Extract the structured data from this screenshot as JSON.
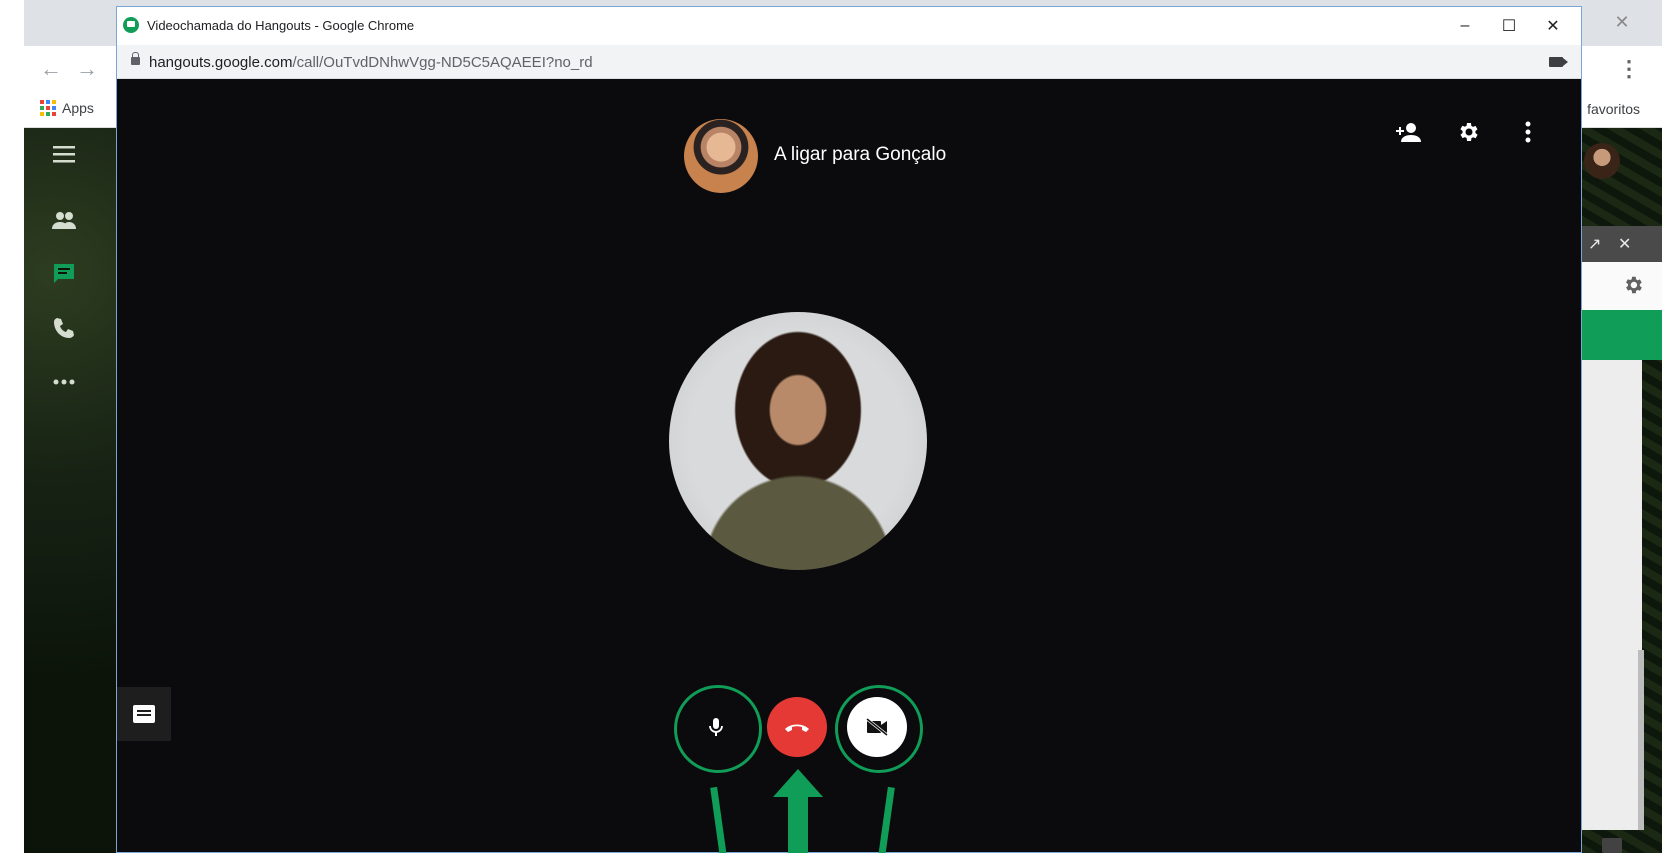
{
  "background_browser": {
    "apps_label": "Apps",
    "bookmark_right_label": "favoritos",
    "close_glyph": "✕",
    "nav_back": "←",
    "nav_forward": "→",
    "menu_glyph": "⋮"
  },
  "hangouts_rail": {
    "icons": [
      "menu-icon",
      "contacts-icon",
      "chat-icon",
      "phone-icon",
      "more-icon"
    ],
    "active_color": "#0f9d58"
  },
  "popup": {
    "title": "Videochamada do Hangouts - Google Chrome",
    "url_domain": "hangouts.google.com",
    "url_path": "/call/OuTvdDNhwVgg-ND5C5AQAEEI?no_rd",
    "minimize_glyph": "–",
    "maximize_glyph": "☐",
    "close_glyph": "✕"
  },
  "call": {
    "status_text": "A ligar para Gonçalo",
    "top_icons": [
      "add-person-icon",
      "settings-icon",
      "more-vert-icon"
    ],
    "controls": [
      "mic",
      "hang-up",
      "camera-off"
    ],
    "accent_color": "#0f9d58",
    "hangup_color": "#e53935"
  },
  "right_panel": {
    "expand_glyph": "↗",
    "close_glyph": "✕"
  }
}
